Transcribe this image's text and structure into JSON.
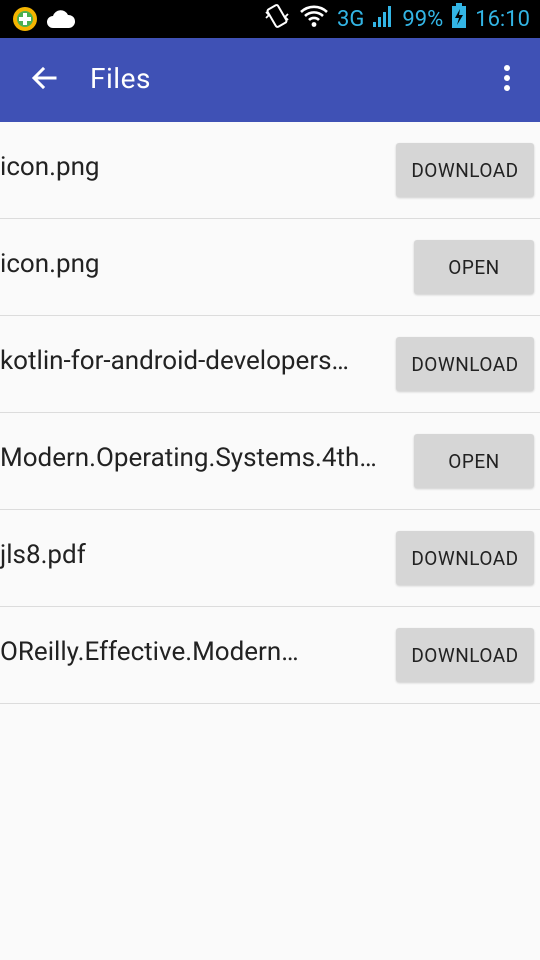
{
  "status_bar": {
    "network": "3G",
    "battery": "99%",
    "time": "16:10",
    "accent_color": "#33b5e5"
  },
  "app_bar": {
    "title": "Files",
    "color": "#3f51b5"
  },
  "files": [
    {
      "name": "icon.png",
      "action": "DOWNLOAD"
    },
    {
      "name": "icon.png",
      "action": "OPEN"
    },
    {
      "name": "kotlin-for-android-developers…",
      "action": "DOWNLOAD"
    },
    {
      "name": "Modern.Operating.Systems.4th…",
      "action": "OPEN"
    },
    {
      "name": "jls8.pdf",
      "action": "DOWNLOAD"
    },
    {
      "name": "OReilly.Effective.Modern…",
      "action": "DOWNLOAD"
    }
  ]
}
